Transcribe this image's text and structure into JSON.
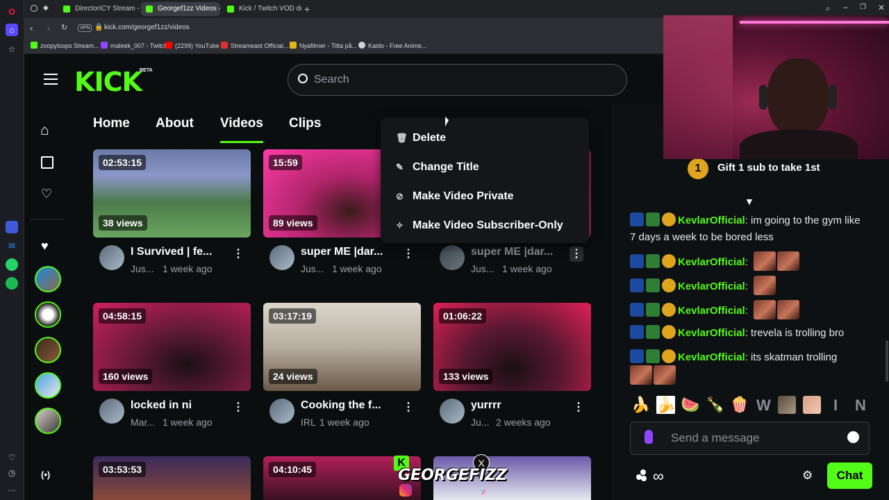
{
  "browser": {
    "tabs": [
      {
        "label": "DirectorICY Stream - Wat...",
        "favicon_color": "#53fc18"
      },
      {
        "label": "Georgef1zz Videos - Watc...",
        "favicon_color": "#53fc18"
      },
      {
        "label": "Kick / Twitch VOD downlo...",
        "favicon_color": "#53fc18"
      }
    ],
    "vpn_label": "VPN",
    "url": "kick.com/georgef1zz/videos",
    "bookmarks": [
      {
        "label": "zoopyloops Stream...",
        "color": "#53fc18"
      },
      {
        "label": "maleek_007 - Twitch",
        "color": "#9146ff"
      },
      {
        "label": "(2299) YouTube",
        "color": "#ff0000"
      },
      {
        "label": "Streameast Official...",
        "color": "#e03131"
      },
      {
        "label": "Nyafilmer - Titta på...",
        "color": "#e0b51e"
      },
      {
        "label": "Kaido - Free Anime...",
        "color": "#cfd4da"
      }
    ]
  },
  "kick": {
    "logo": "KICK",
    "logo_badge": "BETA",
    "search_placeholder": "Search",
    "tabs": [
      "Home",
      "About",
      "Videos",
      "Clips"
    ],
    "active_tab": "Videos",
    "brand_color": "#53fc18"
  },
  "context_menu": [
    {
      "label": "Delete",
      "icon": "trash-icon"
    },
    {
      "label": "Change Title",
      "icon": "pencil-icon"
    },
    {
      "label": "Make Video Private",
      "icon": "eye-off-icon"
    },
    {
      "label": "Make Video Subscriber-Only",
      "icon": "sparkle-icon"
    }
  ],
  "videos": [
    {
      "duration": "02:53:15",
      "views": "38 views",
      "title": "I Survived | fe...",
      "category": "Jus...",
      "age": "1 week ago"
    },
    {
      "duration": "15:59",
      "views": "89 views",
      "title": "super ME |dar...",
      "category": "Jus...",
      "age": "1 week ago"
    },
    {
      "duration": "",
      "views": "",
      "title": "super ME |dar...",
      "category": "Jus...",
      "age": "1 week ago"
    },
    {
      "duration": "04:58:15",
      "views": "160 views",
      "title": "locked in ni",
      "category": "Mar...",
      "age": "1 week ago"
    },
    {
      "duration": "03:17:19",
      "views": "24 views",
      "title": "Cooking the f...",
      "category": "IRL",
      "age": "1 week ago"
    },
    {
      "duration": "01:06:22",
      "views": "133 views",
      "title": "yurrrr",
      "category": "Ju...",
      "age": "2 weeks ago"
    },
    {
      "duration": "03:53:53",
      "views": "",
      "title": "",
      "category": "",
      "age": ""
    },
    {
      "duration": "04:10:45",
      "views": "",
      "title": "",
      "category": "",
      "age": ""
    }
  ],
  "overlay": {
    "streamer_tag": "GEORGEFIZZ"
  },
  "chat": {
    "gift_text": "Gift 1 sub to take 1st",
    "gift_rank": "1",
    "messages": [
      {
        "user": "KevlarOfficial",
        "text": ": im going to the gym like 7 days a week to be bored less"
      },
      {
        "user": "KevlarOfficial",
        "text": ":"
      },
      {
        "user": "KevlarOfficial",
        "text": ":"
      },
      {
        "user": "KevlarOfficial",
        "text": ":"
      },
      {
        "user": "KevlarOfficial",
        "text": ": trevela is trolling bro"
      },
      {
        "user": "KevlarOfficial",
        "text": ": its skatman trolling"
      }
    ],
    "emote_bar": [
      "🍌",
      "🍌",
      "🍉",
      "🍾",
      "🍿",
      "W",
      "",
      "",
      "I",
      "N"
    ],
    "input_placeholder": "Send a message",
    "send_label": "Chat"
  }
}
